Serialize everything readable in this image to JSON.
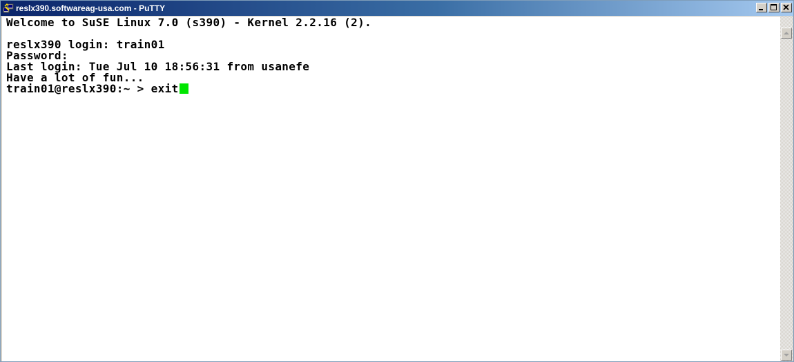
{
  "window": {
    "title": "reslx390.softwareag-usa.com - PuTTY",
    "icon": "putty-icon",
    "buttons": [
      "minimize-icon",
      "maximize-icon",
      "close-icon"
    ]
  },
  "terminal": {
    "lines": [
      "Welcome to SuSE Linux 7.0 (s390) - Kernel 2.2.16 (2).",
      "",
      "reslx390 login: train01",
      "Password:",
      "Last login: Tue Jul 10 18:56:31 from usanefe",
      "Have a lot of fun...",
      "train01@reslx390:~ > exit"
    ],
    "cursor_color": "#00e600",
    "background_color": "#ffffff",
    "text_color": "#000000"
  },
  "scrollbar": {
    "up_icon": "scroll-up-arrow-icon",
    "down_icon": "scroll-down-arrow-icon"
  }
}
